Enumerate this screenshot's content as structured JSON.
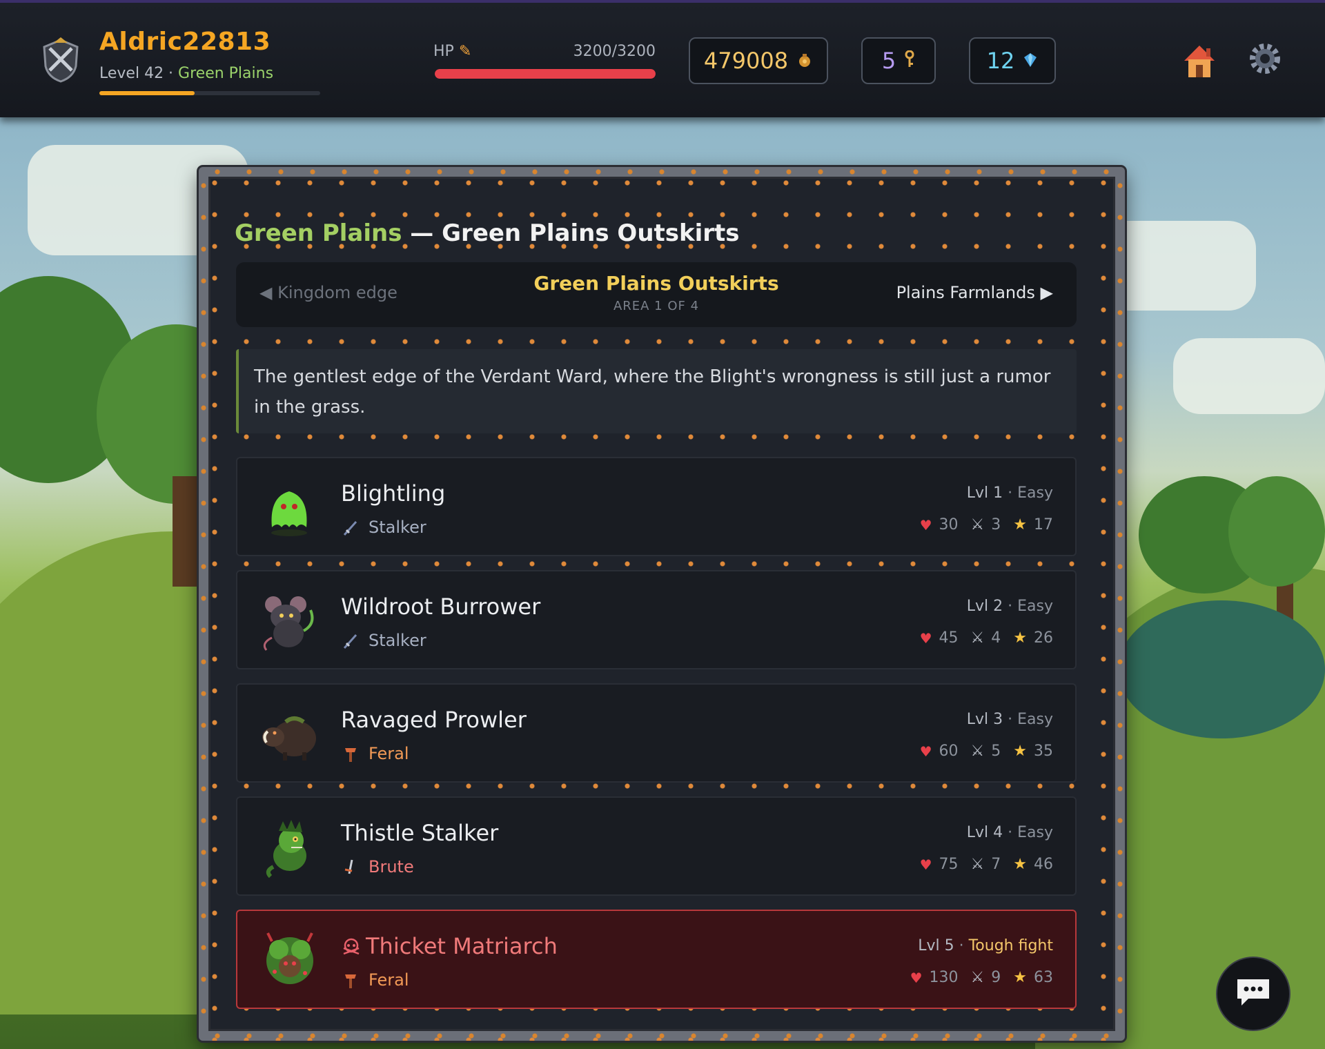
{
  "player": {
    "name": "Aldric22813",
    "level_text": "Level 42",
    "separator": " · ",
    "zone": "Green Plains",
    "xp_fraction": 0.43
  },
  "hp": {
    "label": "HP",
    "value_text": "3200/3200",
    "fraction": 1.0
  },
  "currencies": {
    "gold": "479008",
    "keys": "5",
    "gems": "12"
  },
  "panel": {
    "title_region": "Green Plains",
    "title_dash": " — ",
    "title_area": "Green Plains Outskirts"
  },
  "area_nav": {
    "prev_label": "Kingdom edge",
    "current_name": "Green Plains Outskirts",
    "current_index": "AREA 1 OF 4",
    "next_label": "Plains Farmlands"
  },
  "description": "The gentlest edge of the Verdant Ward, where the Blight's wrongness is still just a rumor in the grass.",
  "enemies": [
    {
      "name": "Blightling",
      "class": "Stalker",
      "level": "Lvl 1",
      "difficulty": "Easy",
      "hp": "30",
      "atk": "3",
      "xp": "17"
    },
    {
      "name": "Wildroot Burrower",
      "class": "Stalker",
      "level": "Lvl 2",
      "difficulty": "Easy",
      "hp": "45",
      "atk": "4",
      "xp": "26"
    },
    {
      "name": "Ravaged Prowler",
      "class": "Feral",
      "level": "Lvl 3",
      "difficulty": "Easy",
      "hp": "60",
      "atk": "5",
      "xp": "35"
    },
    {
      "name": "Thistle Stalker",
      "class": "Brute",
      "level": "Lvl 4",
      "difficulty": "Easy",
      "hp": "75",
      "atk": "7",
      "xp": "46"
    },
    {
      "name": "Thicket Matriarch",
      "class": "Feral",
      "level": "Lvl 5",
      "difficulty": "Tough fight",
      "hp": "130",
      "atk": "9",
      "xp": "63"
    }
  ],
  "level_sep": " · ",
  "colors": {
    "accent_gold": "#f5a623",
    "hp_red": "#e8404a",
    "region_green": "#a4cf63",
    "area_yellow": "#f2cf5a",
    "tough_bg": "#3a1216",
    "tough_border": "#b8383b"
  },
  "icons": {
    "avatar": "crossed-swords-shield-icon",
    "gold": "coin-pouch-icon",
    "keys": "key-icon",
    "gems": "gem-icon",
    "home": "home-icon",
    "settings": "gear-icon",
    "chat": "chat-bubble-icon",
    "hp": "heart-icon",
    "attack": "sword-icon",
    "xp": "star-icon",
    "boss": "skull-icon"
  }
}
